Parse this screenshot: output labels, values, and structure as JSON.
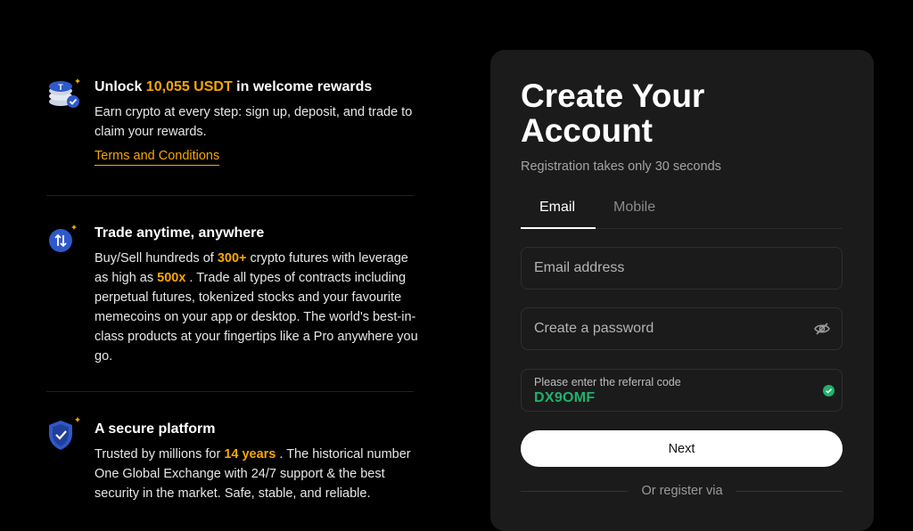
{
  "features": [
    {
      "icon": "usdt-coins-check-icon",
      "title_pre": "Unlock ",
      "title_hl": "10,055 USDT",
      "title_post": " in welcome rewards",
      "body": "Earn crypto at every step: sign up, deposit, and trade to claim your rewards.",
      "link": "Terms and Conditions"
    },
    {
      "icon": "trade-arrows-icon",
      "title": "Trade anytime, anywhere",
      "body_1": "Buy/Sell hundreds of ",
      "hl_1": "300+",
      "body_2": " crypto futures with leverage as high as ",
      "hl_2": "500x",
      "body_3": " . Trade all types of contracts including perpetual futures, tokenized stocks and your favourite memecoins on your app or desktop. The world's best-in-class products at your fingertips like a Pro anywhere you go."
    },
    {
      "icon": "shield-check-icon",
      "title": "A secure platform",
      "body_1": "Trusted by millions for ",
      "hl_1": "14 years",
      "body_2": " . The historical number One Global Exchange with 24/7 support & the best security in the market. Safe, stable, and reliable."
    }
  ],
  "signup": {
    "title": "Create Your Account",
    "subtitle": "Registration takes only 30 seconds",
    "tabs": [
      "Email",
      "Mobile"
    ],
    "active_tab": "Email",
    "email_placeholder": "Email address",
    "password_placeholder": "Create a password",
    "referral_label": "Please enter the referral code",
    "referral_value": "DX9OMF",
    "next_label": "Next",
    "or_text": "Or register via"
  },
  "colors": {
    "accent": "#f7a600",
    "success": "#20b26c",
    "icon_blue": "#2f58c9",
    "card_bg": "#1b1b1c"
  }
}
